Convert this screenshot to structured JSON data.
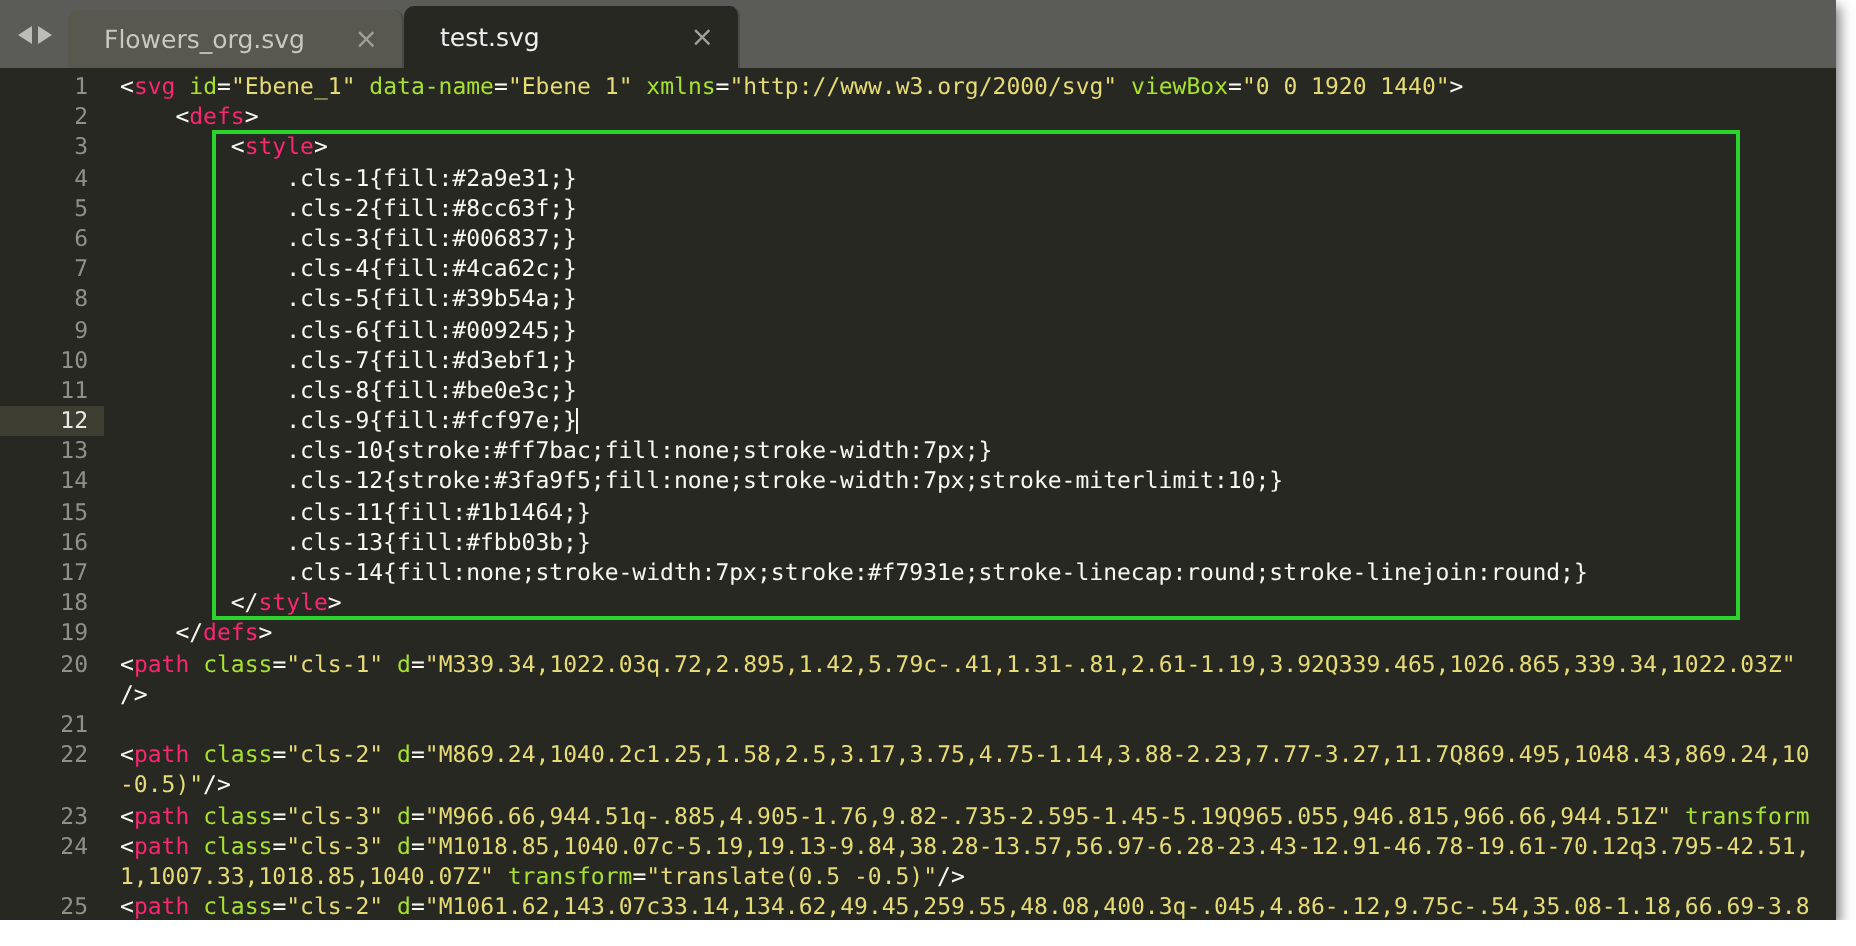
{
  "tabs": [
    {
      "label": "Flowers_org.svg",
      "selected": false,
      "close": "×"
    },
    {
      "label": "test.svg",
      "selected": true,
      "close": "×"
    }
  ],
  "blocks": [
    {
      "kind": "plain",
      "lines": [
        {
          "number": "1",
          "rows": [
            {
              "tokens": [
                {
                  "kind": "p",
                  "text": "<"
                },
                {
                  "kind": "tag",
                  "text": "svg"
                },
                {
                  "kind": "attr",
                  "text": " id"
                },
                {
                  "kind": "p",
                  "text": "="
                },
                {
                  "kind": "str",
                  "text": "\"Ebene_1\""
                },
                {
                  "kind": "attr",
                  "text": " data-name"
                },
                {
                  "kind": "p",
                  "text": "="
                },
                {
                  "kind": "str",
                  "text": "\"Ebene 1\""
                },
                {
                  "kind": "attr",
                  "text": " xmlns"
                },
                {
                  "kind": "p",
                  "text": "="
                },
                {
                  "kind": "str",
                  "text": "\"http://www.w3.org/2000/svg\""
                },
                {
                  "kind": "attr",
                  "text": " viewBox"
                },
                {
                  "kind": "p",
                  "text": "="
                },
                {
                  "kind": "str",
                  "text": "\"0 0 1920 1440\""
                },
                {
                  "kind": "p",
                  "text": ">"
                }
              ]
            }
          ]
        },
        {
          "number": "2",
          "rows": [
            {
              "tokens": [
                {
                  "kind": "p",
                  "text": "    <"
                },
                {
                  "kind": "tag",
                  "text": "defs"
                },
                {
                  "kind": "p",
                  "text": ">"
                }
              ]
            }
          ]
        }
      ]
    },
    {
      "kind": "framed",
      "lines": [
        {
          "number": "3",
          "rows": [
            {
              "tokens": [
                {
                  "kind": "p",
                  "text": "        <"
                },
                {
                  "kind": "tag",
                  "text": "style"
                },
                {
                  "kind": "p",
                  "text": ">"
                }
              ]
            }
          ]
        },
        {
          "number": "4",
          "rows": [
            {
              "tokens": [
                {
                  "kind": "p",
                  "text": "            .cls-1{fill:#2a9e31;}"
                }
              ]
            }
          ]
        },
        {
          "number": "5",
          "rows": [
            {
              "tokens": [
                {
                  "kind": "p",
                  "text": "            .cls-2{fill:#8cc63f;}"
                }
              ]
            }
          ]
        },
        {
          "number": "6",
          "rows": [
            {
              "tokens": [
                {
                  "kind": "p",
                  "text": "            .cls-3{fill:#006837;}"
                }
              ]
            }
          ]
        },
        {
          "number": "7",
          "rows": [
            {
              "tokens": [
                {
                  "kind": "p",
                  "text": "            .cls-4{fill:#4ca62c;}"
                }
              ]
            }
          ]
        },
        {
          "number": "8",
          "rows": [
            {
              "tokens": [
                {
                  "kind": "p",
                  "text": "            .cls-5{fill:#39b54a;}"
                }
              ]
            }
          ]
        },
        {
          "number": "9",
          "rows": [
            {
              "tokens": [
                {
                  "kind": "p",
                  "text": "            .cls-6{fill:#009245;}"
                }
              ]
            }
          ]
        },
        {
          "number": "10",
          "rows": [
            {
              "tokens": [
                {
                  "kind": "p",
                  "text": "            .cls-7{fill:#d3ebf1;}"
                }
              ]
            }
          ]
        },
        {
          "number": "11",
          "rows": [
            {
              "tokens": [
                {
                  "kind": "p",
                  "text": "            .cls-8{fill:#be0e3c;}"
                }
              ]
            }
          ]
        },
        {
          "number": "12",
          "current": true,
          "rows": [
            {
              "tokens": [
                {
                  "kind": "p",
                  "text": "            .cls-9{fill:#fcf97e;}"
                }
              ]
            }
          ]
        },
        {
          "number": "13",
          "rows": [
            {
              "tokens": [
                {
                  "kind": "p",
                  "text": "            .cls-10{stroke:#ff7bac;fill:none;stroke-width:7px;}"
                }
              ]
            }
          ]
        },
        {
          "number": "14",
          "rows": [
            {
              "tokens": [
                {
                  "kind": "p",
                  "text": "            .cls-12{stroke:#3fa9f5;fill:none;stroke-width:7px;stroke-miterlimit:10;}"
                }
              ]
            }
          ]
        },
        {
          "number": "15",
          "rows": [
            {
              "tokens": [
                {
                  "kind": "p",
                  "text": "            .cls-11{fill:#1b1464;}"
                }
              ]
            }
          ]
        },
        {
          "number": "16",
          "rows": [
            {
              "tokens": [
                {
                  "kind": "p",
                  "text": "            .cls-13{fill:#fbb03b;}"
                }
              ]
            }
          ]
        },
        {
          "number": "17",
          "rows": [
            {
              "tokens": [
                {
                  "kind": "p",
                  "text": "            .cls-14{fill:none;stroke-width:7px;stroke:#f7931e;stroke-linecap:round;stroke-linejoin:round;}"
                }
              ]
            }
          ]
        },
        {
          "number": "18",
          "rows": [
            {
              "tokens": [
                {
                  "kind": "p",
                  "text": "        </"
                },
                {
                  "kind": "tag",
                  "text": "style"
                },
                {
                  "kind": "p",
                  "text": ">"
                }
              ]
            }
          ]
        }
      ]
    },
    {
      "kind": "plain",
      "lines": [
        {
          "number": "19",
          "rows": [
            {
              "tokens": [
                {
                  "kind": "p",
                  "text": "    </"
                },
                {
                  "kind": "tag",
                  "text": "defs"
                },
                {
                  "kind": "p",
                  "text": ">"
                }
              ]
            }
          ]
        },
        {
          "number": "20",
          "rows": [
            {
              "tokens": [
                {
                  "kind": "p",
                  "text": "<"
                },
                {
                  "kind": "tag",
                  "text": "path"
                },
                {
                  "kind": "attr",
                  "text": " class"
                },
                {
                  "kind": "p",
                  "text": "="
                },
                {
                  "kind": "str",
                  "text": "\"cls-1\""
                },
                {
                  "kind": "attr",
                  "text": " d"
                },
                {
                  "kind": "p",
                  "text": "="
                },
                {
                  "kind": "str",
                  "text": "\"M339.34,1022.03q.72,2.895,1.42,5.79c-.41,1.31-.81,2.61-1.19,3.92Q339.465,1026.865,339.34,1022.03Z\""
                }
              ]
            },
            {
              "tokens": [
                {
                  "kind": "p",
                  "text": "/>"
                }
              ]
            }
          ]
        },
        {
          "number": "21"
        },
        {
          "number": "22",
          "rows": [
            {
              "tokens": [
                {
                  "kind": "p",
                  "text": "<"
                },
                {
                  "kind": "tag",
                  "text": "path"
                },
                {
                  "kind": "attr",
                  "text": " class"
                },
                {
                  "kind": "p",
                  "text": "="
                },
                {
                  "kind": "str",
                  "text": "\"cls-2\""
                },
                {
                  "kind": "attr",
                  "text": " d"
                },
                {
                  "kind": "p",
                  "text": "="
                },
                {
                  "kind": "str",
                  "text": "\"M869.24,1040.2c1.25,1.58,2.5,3.17,3.75,4.75-1.14,3.88-2.23,7.77-3.27,11.7Q869.495,1048.43,869.24,10"
                }
              ]
            },
            {
              "tokens": [
                {
                  "kind": "str",
                  "text": "-0.5)\""
                },
                {
                  "kind": "p",
                  "text": "/>"
                }
              ]
            }
          ]
        },
        {
          "number": "23",
          "rows": [
            {
              "tokens": [
                {
                  "kind": "p",
                  "text": "<"
                },
                {
                  "kind": "tag",
                  "text": "path"
                },
                {
                  "kind": "attr",
                  "text": " class"
                },
                {
                  "kind": "p",
                  "text": "="
                },
                {
                  "kind": "str",
                  "text": "\"cls-3\""
                },
                {
                  "kind": "attr",
                  "text": " d"
                },
                {
                  "kind": "p",
                  "text": "="
                },
                {
                  "kind": "str",
                  "text": "\"M966.66,944.51q-.885,4.905-1.76,9.82-.735-2.595-1.45-5.19Q965.055,946.815,966.66,944.51Z\""
                },
                {
                  "kind": "attr",
                  "text": " transform"
                }
              ]
            }
          ]
        },
        {
          "number": "24",
          "rows": [
            {
              "tokens": [
                {
                  "kind": "p",
                  "text": "<"
                },
                {
                  "kind": "tag",
                  "text": "path"
                },
                {
                  "kind": "attr",
                  "text": " class"
                },
                {
                  "kind": "p",
                  "text": "="
                },
                {
                  "kind": "str",
                  "text": "\"cls-3\""
                },
                {
                  "kind": "attr",
                  "text": " d"
                },
                {
                  "kind": "p",
                  "text": "="
                },
                {
                  "kind": "str",
                  "text": "\"M1018.85,1040.07c-5.19,19.13-9.84,38.28-13.57,56.97-6.28-23.43-12.91-46.78-19.61-70.12q3.795-42.51,"
                }
              ]
            },
            {
              "tokens": [
                {
                  "kind": "str",
                  "text": "1,1007.33,1018.85,1040.07Z\""
                },
                {
                  "kind": "attr",
                  "text": " transform"
                },
                {
                  "kind": "p",
                  "text": "="
                },
                {
                  "kind": "str",
                  "text": "\"translate(0.5 -0.5)\""
                },
                {
                  "kind": "p",
                  "text": "/>"
                }
              ]
            }
          ]
        },
        {
          "number": "25",
          "rows": [
            {
              "tokens": [
                {
                  "kind": "p",
                  "text": "<"
                },
                {
                  "kind": "tag",
                  "text": "path"
                },
                {
                  "kind": "attr",
                  "text": " class"
                },
                {
                  "kind": "p",
                  "text": "="
                },
                {
                  "kind": "str",
                  "text": "\"cls-2\""
                },
                {
                  "kind": "attr",
                  "text": " d"
                },
                {
                  "kind": "p",
                  "text": "="
                },
                {
                  "kind": "str",
                  "text": "\"M1061.62,143.07c33.14,134.62,49.45,259.55,48.08,400.3q-.045,4.86-.12,9.75c-.54,35.08-1.18,66.69-3.8"
                }
              ]
            }
          ]
        }
      ]
    }
  ]
}
